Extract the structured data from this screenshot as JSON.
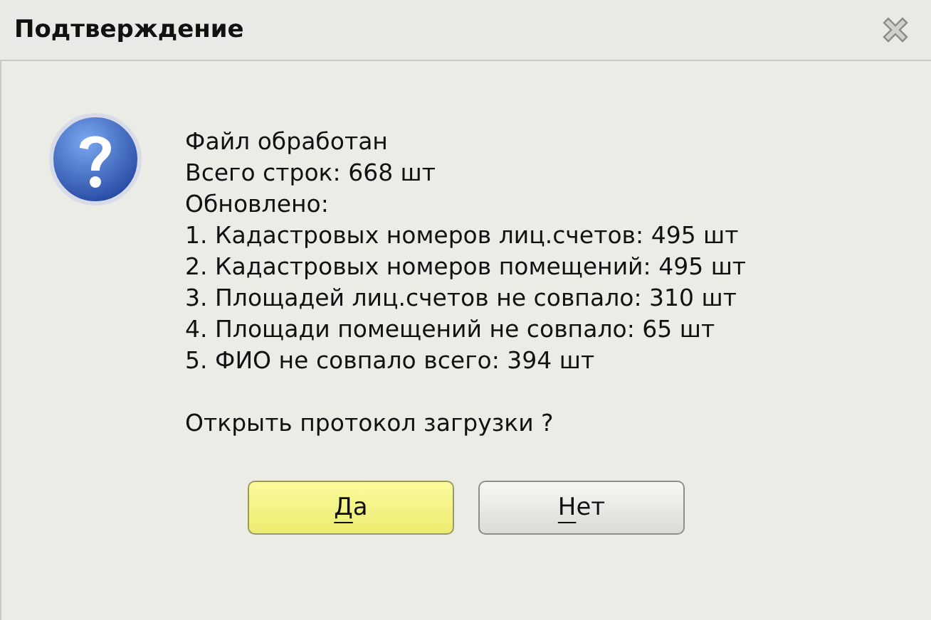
{
  "window": {
    "title": "Подтверждение"
  },
  "message": {
    "lines": [
      "Файл обработан",
      "Всего строк: 668 шт",
      "Обновлено:",
      "1. Кадастровых номеров лиц.счетов: 495 шт",
      "2. Кадастровых номеров помещений: 495 шт",
      "3. Площадей лиц.счетов не совпало: 310 шт",
      "4. Площади помещений не совпало: 65 шт",
      "5. ФИО не совпало всего: 394 шт"
    ],
    "question": "Открыть протокол загрузки ?"
  },
  "buttons": [
    {
      "label": "Да",
      "first_letter_underlined": true,
      "selected": true
    },
    {
      "label": "Нет",
      "first_letter_underlined": true,
      "selected": false
    }
  ]
}
